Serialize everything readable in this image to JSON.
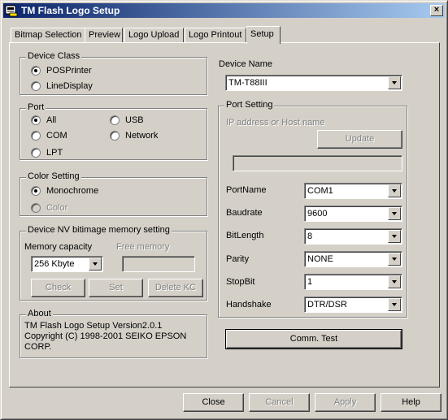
{
  "window": {
    "title": "TM Flash Logo Setup",
    "close_glyph": "×"
  },
  "tabs": [
    "Bitmap Selection",
    "Preview",
    "Logo Upload",
    "Logo Printout",
    "Setup"
  ],
  "device_class": {
    "title": "Device Class",
    "options": [
      "POSPrinter",
      "LineDisplay"
    ],
    "selected": "POSPrinter"
  },
  "port": {
    "title": "Port",
    "options": [
      "All",
      "USB",
      "COM",
      "Network",
      "LPT"
    ],
    "selected": "All"
  },
  "color_setting": {
    "title": "Color Setting",
    "options": [
      "Monochrome",
      "Color"
    ],
    "selected": "Monochrome"
  },
  "nv_memory": {
    "title": "Device NV bitimage memory setting",
    "memory_capacity_label": "Memory capacity",
    "memory_capacity_value": "256 Kbyte",
    "free_memory_label": "Free memory",
    "free_memory_value": "",
    "check_label": "Check",
    "set_label": "Set",
    "delete_label": "Delete KC"
  },
  "about": {
    "title": "About",
    "lines": [
      "TM Flash Logo Setup Version2.0.1",
      "Copyright (C) 1998-2001 SEIKO EPSON",
      "CORP."
    ]
  },
  "device_name": {
    "label": "Device Name",
    "value": "TM-T88III"
  },
  "port_setting": {
    "title": "Port Setting",
    "ip_label": "IP address or Host name",
    "update_label": "Update",
    "ip_value": "",
    "fields": [
      {
        "label": "PortName",
        "value": "COM1"
      },
      {
        "label": "Baudrate",
        "value": "9600"
      },
      {
        "label": "BitLength",
        "value": "8"
      },
      {
        "label": "Parity",
        "value": "NONE"
      },
      {
        "label": "StopBit",
        "value": "1"
      },
      {
        "label": "Handshake",
        "value": "DTR/DSR"
      }
    ]
  },
  "comm_test_label": "Comm. Test",
  "footer": {
    "close": "Close",
    "cancel": "Cancel",
    "apply": "Apply",
    "help": "Help"
  }
}
